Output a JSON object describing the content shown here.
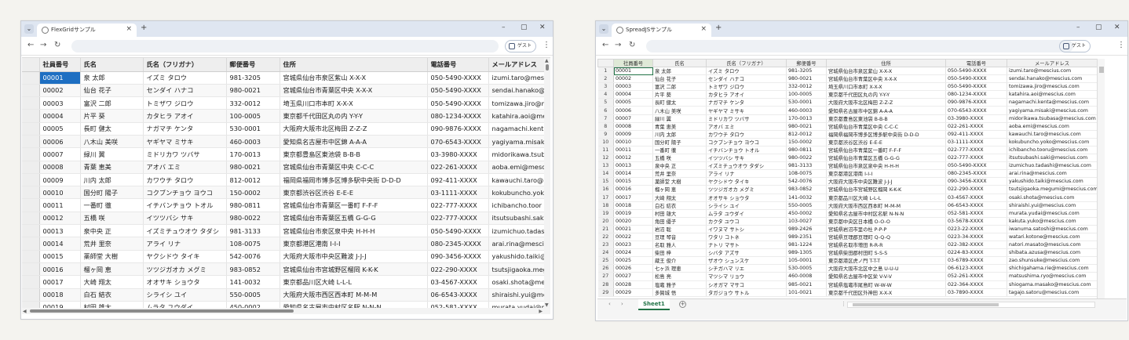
{
  "flexgrid_window": {
    "tab_title": "FlexGridサンプル",
    "guest_label": "ゲスト",
    "headers": [
      "社員番号",
      "氏名",
      "氏名（フリガナ）",
      "郵便番号",
      "住所",
      "電話番号",
      "メールアドレス"
    ],
    "rows": [
      [
        "00001",
        "泉 太郎",
        "イズミ タロウ",
        "981-3205",
        "宮城県仙台市泉区紫山 X-X-X",
        "050-5490-XXXX",
        "izumi.taro@mes"
      ],
      [
        "00002",
        "仙台 花子",
        "センダイ ハナコ",
        "980-0021",
        "宮城県仙台市青葉区中央 X-X-X",
        "050-5490-XXXX",
        "sendai.hanako@"
      ],
      [
        "00003",
        "富沢 二郎",
        "トミザワ ジロウ",
        "332-0012",
        "埼玉県川口市本町 X-X-X",
        "050-5490-XXXX",
        "tomizawa.jiro@m"
      ],
      [
        "00004",
        "片平 葵",
        "カタヒラ アオイ",
        "100-0005",
        "東京都千代田区丸の内 Y-Y-Y",
        "080-1234-XXXX",
        "katahira.aoi@me"
      ],
      [
        "00005",
        "長町 健太",
        "ナガマチ ケンタ",
        "530-0001",
        "大阪府大阪市北区梅田 Z-Z-Z",
        "090-9876-XXXX",
        "nagamachi.kent"
      ],
      [
        "00006",
        "八木山 美咲",
        "ヤギヤマ ミサキ",
        "460-0003",
        "愛知県名古屋市中区錦 A-A-A",
        "070-6543-XXXX",
        "yagiyama.misak"
      ],
      [
        "00007",
        "緑川 翼",
        "ミドリカワ ツバサ",
        "170-0013",
        "東京都豊島区東池袋 B-B-B",
        "03-3980-XXXX",
        "midorikawa.tsub"
      ],
      [
        "00008",
        "青葉 恵美",
        "アオバ エミ",
        "980-0021",
        "宮城県仙台市青葉区中央 C-C-C",
        "022-261-XXXX",
        "aoba.emi@mesc"
      ],
      [
        "00009",
        "川内 太郎",
        "カワウチ タロウ",
        "812-0012",
        "福岡県福岡市博多区博多駅中央街 D-D-D",
        "092-411-XXXX",
        "kawauchi.taro@"
      ],
      [
        "00010",
        "国分町 陽子",
        "コクブンチョウ ヨウコ",
        "150-0002",
        "東京都渋谷区渋谷 E-E-E",
        "03-1111-XXXX",
        "kokubuncho.yok"
      ],
      [
        "00011",
        "一番町 徹",
        "イチバンチョウ トオル",
        "980-0811",
        "宮城県仙台市青葉区一番町 F-F-F",
        "022-777-XXXX",
        "ichibancho.toor"
      ],
      [
        "00012",
        "五橋 咲",
        "イツツバシ サキ",
        "980-0022",
        "宮城県仙台市青葉区五橋 G-G-G",
        "022-777-XXXX",
        "itsutsubashi.sak"
      ],
      [
        "00013",
        "泉中央 正",
        "イズミチュウオウ タダシ",
        "981-3133",
        "宮城県仙台市泉区泉中央 H-H-H",
        "050-5490-XXXX",
        "izumichuo.tadas"
      ],
      [
        "00014",
        "荒井 里奈",
        "アライ リナ",
        "108-0075",
        "東京都港区港南 I-I-I",
        "080-2345-XXXX",
        "arai.rina@mesci"
      ],
      [
        "00015",
        "薬師堂 大樹",
        "ヤクシドウ タイキ",
        "542-0076",
        "大阪府大阪市中央区難波 J-J-J",
        "090-3456-XXXX",
        "yakushido.taiki@"
      ],
      [
        "00016",
        "榴ヶ岡 恵",
        "ツツジガオカ メグミ",
        "983-0852",
        "宮城県仙台市宮城野区榴岡 K-K-K",
        "022-290-XXXX",
        "tsutsjigaoka.meg"
      ],
      [
        "00017",
        "大崎 翔太",
        "オオサキ ショウタ",
        "141-0032",
        "東京都品川区大崎 L-L-L",
        "03-4567-XXXX",
        "osaki.shota@me"
      ],
      [
        "00018",
        "白石 結衣",
        "シライシ ユイ",
        "550-0005",
        "大阪府大阪市西区西本町 M-M-M",
        "06-6543-XXXX",
        "shiraishi.yui@me"
      ],
      [
        "00019",
        "村田 雄大",
        "ムラタ ユウダイ",
        "450-0002",
        "愛知県名古屋市中村区名駅 N-N-N",
        "052-581-XXXX",
        "murata.yudai@me"
      ]
    ]
  },
  "spread_window": {
    "tab_title": "SpreadJSサンプル",
    "guest_label": "ゲスト",
    "sheet_name": "Sheet1",
    "headers": [
      "社員番号",
      "氏名",
      "氏名（フリガナ）",
      "郵便番号",
      "住所",
      "電話番号",
      "メールアドレス"
    ],
    "rows": [
      [
        "1",
        "00001",
        "泉 太郎",
        "イズミ タロウ",
        "981-3205",
        "宮城県仙台市泉区紫山 X-X-X",
        "050-5490-XXXX",
        "izumi.taro@mescius.com"
      ],
      [
        "2",
        "00002",
        "仙台 花子",
        "センダイ ハナコ",
        "980-0021",
        "宮城県仙台市青葉区中央 X-X-X",
        "050-5490-XXXX",
        "sendai.hanako@mescius.com"
      ],
      [
        "3",
        "00003",
        "富沢 二郎",
        "トミザワ ジロウ",
        "332-0012",
        "埼玉県川口市本町 X-X-X",
        "050-5490-XXXX",
        "tomizawa.jiro@mescius.com"
      ],
      [
        "4",
        "00004",
        "片平 葵",
        "カタヒラ アオイ",
        "100-0005",
        "東京都千代田区丸の内 Y-Y-Y",
        "080-1234-XXXX",
        "katahira.aoi@mescius.com"
      ],
      [
        "5",
        "00005",
        "長町 健太",
        "ナガマチ ケンタ",
        "530-0001",
        "大阪府大阪市北区梅田 Z-Z-Z",
        "090-9876-XXXX",
        "nagamachi.kenta@mescius.com"
      ],
      [
        "6",
        "00006",
        "八木山 美咲",
        "ヤギヤマ ミサキ",
        "460-0003",
        "愛知県名古屋市中区錦 A-A-A",
        "070-6543-XXXX",
        "yagiyama.misaki@mescius.com"
      ],
      [
        "7",
        "00007",
        "緑川 翼",
        "ミドリカワ ツバサ",
        "170-0013",
        "東京都豊島区東池袋 B-B-B",
        "03-3980-XXXX",
        "midorikawa.tsubasa@mescius.com"
      ],
      [
        "8",
        "00008",
        "青葉 恵美",
        "アオバ エミ",
        "980-0021",
        "宮城県仙台市青葉区中央 C-C-C",
        "022-261-XXXX",
        "aoba.emi@mescius.com"
      ],
      [
        "9",
        "00009",
        "川内 太郎",
        "カワウチ タロウ",
        "812-0012",
        "福岡県福岡市博多区博多駅中央街 D-D-D",
        "092-411-XXXX",
        "kawauchi.taro@mescius.com"
      ],
      [
        "10",
        "00010",
        "国分町 陽子",
        "コクブンチョウ ヨウコ",
        "150-0002",
        "東京都渋谷区渋谷 E-E-E",
        "03-1111-XXXX",
        "kokubuncho.yoko@mescius.com"
      ],
      [
        "11",
        "00011",
        "一番町 徹",
        "イチバンチョウ トオル",
        "980-0811",
        "宮城県仙台市青葉区一番町 F-F-F",
        "022-777-XXXX",
        "ichibancho.tooru@mescius.com"
      ],
      [
        "12",
        "00012",
        "五橋 咲",
        "イツツバシ サキ",
        "980-0022",
        "宮城県仙台市青葉区五橋 G-G-G",
        "022-777-XXXX",
        "itsutsubashi.saki@mescius.com"
      ],
      [
        "13",
        "00013",
        "泉中央 正",
        "イズミチュウオウ タダシ",
        "981-3133",
        "宮城県仙台市泉区泉中央 H-H-H",
        "050-5490-XXXX",
        "izumichuo.tadashi@mescius.com"
      ],
      [
        "14",
        "00014",
        "荒井 里奈",
        "アライ リナ",
        "108-0075",
        "東京都港区港南 I-I-I",
        "080-2345-XXXX",
        "arai.rina@mescius.com"
      ],
      [
        "15",
        "00015",
        "薬師堂 大樹",
        "ヤクシドウ タイキ",
        "542-0076",
        "大阪府大阪市中央区難波 J-J-J",
        "090-3456-XXXX",
        "yakushido.taiki@mescius.com"
      ],
      [
        "16",
        "00016",
        "榴ヶ岡 恵",
        "ツツジガオカ メグミ",
        "983-0852",
        "宮城県仙台市宮城野区榴岡 K-K-K",
        "022-290-XXXX",
        "tsutsjigaoka.megumi@mescius.com"
      ],
      [
        "17",
        "00017",
        "大崎 翔太",
        "オオサキ ショウタ",
        "141-0032",
        "東京都品川区大崎 L-L-L",
        "03-4567-XXXX",
        "osaki.shota@mescius.com"
      ],
      [
        "18",
        "00018",
        "白石 結衣",
        "シライシ ユイ",
        "550-0005",
        "大阪府大阪市西区西本町 M-M-M",
        "06-6543-XXXX",
        "shiraishi.yui@mescius.com"
      ],
      [
        "19",
        "00019",
        "村田 雄大",
        "ムラタ ユウダイ",
        "450-0002",
        "愛知県名古屋市中村区名駅 N-N-N",
        "052-581-XXXX",
        "murata.yudai@mescius.com"
      ],
      [
        "20",
        "00020",
        "角田 優子",
        "カクタ ユウコ",
        "103-0027",
        "東京都中央区日本橋 O-O-O",
        "03-5678-XXXX",
        "kakuta.yuko@mescius.com"
      ],
      [
        "21",
        "00021",
        "岩沼 聡",
        "イワヌマ サトシ",
        "989-2426",
        "宮城県岩沼市里の杜 P-P-P",
        "0223-22-XXXX",
        "iwanuma.satoshi@mescius.com"
      ],
      [
        "22",
        "00022",
        "亘理 琴音",
        "ワタリ コトネ",
        "989-2351",
        "宮城県亘理郡亘理町 Q-Q-Q",
        "0223-34-XXXX",
        "watari.kotone@mescius.com"
      ],
      [
        "23",
        "00023",
        "名取 雅人",
        "ナトリ マサト",
        "981-1224",
        "宮城県名取市増田 R-R-R",
        "022-382-XXXX",
        "natori.masato@mescius.com"
      ],
      [
        "24",
        "00024",
        "柴田 梓",
        "シバタ アズサ",
        "989-1305",
        "宮城県柴田郡村田町 S-S-S",
        "0224-83-XXXX",
        "shibata.azusa@mescius.com"
      ],
      [
        "25",
        "00025",
        "蔵王 俊介",
        "ザオウ シュンスケ",
        "105-0001",
        "東京都港区虎ノ門 T-T-T",
        "03-6789-XXXX",
        "zao.shunsuke@mescius.com"
      ],
      [
        "26",
        "00026",
        "七ヶ浜 理恵",
        "シチガハマ リエ",
        "530-0005",
        "大阪府大阪市北区中之島 U-U-U",
        "06-6123-XXXX",
        "shichigahama.rie@mescius.com"
      ],
      [
        "27",
        "00027",
        "松島 亮",
        "マツシマ リョウ",
        "460-0008",
        "愛知県名古屋市中区栄 V-V-V",
        "052-261-XXXX",
        "matsushima.ryo@mescius.com"
      ],
      [
        "28",
        "00028",
        "塩竈 雅子",
        "シオガマ マサコ",
        "985-0021",
        "宮城県塩竈市尾島町 W-W-W",
        "022-364-XXXX",
        "shiogama.masako@mescius.com"
      ],
      [
        "29",
        "00029",
        "多賀城 悟",
        "タガジョウ サトル",
        "101-0021",
        "東京都千代田区外神田 X-X-X",
        "03-7890-XXXX",
        "tagajo.satoru@mescius.com"
      ]
    ]
  }
}
